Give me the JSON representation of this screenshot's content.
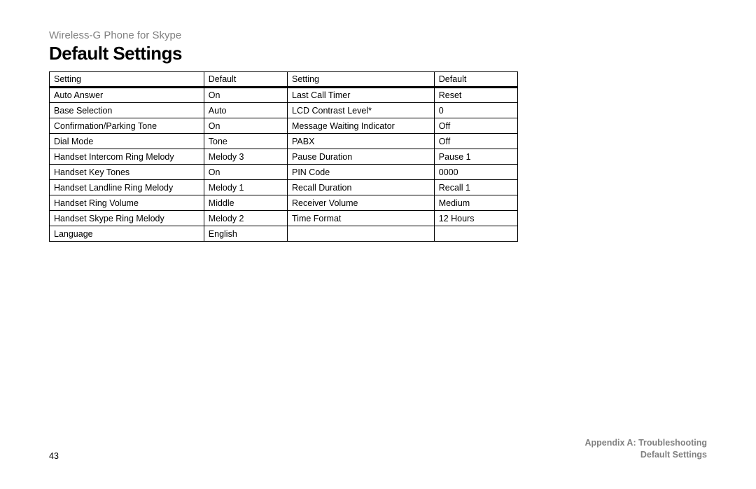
{
  "header": {
    "subtitle": "Wireless-G Phone for Skype",
    "title": "Default Settings"
  },
  "table": {
    "headers": [
      "Setting",
      "Default",
      "Setting",
      "Default"
    ],
    "rows": [
      {
        "c1": "Auto Answer",
        "c2": "On",
        "c3": "Last Call Timer",
        "c4": "Reset"
      },
      {
        "c1": "Base Selection",
        "c2": "Auto",
        "c3": "LCD Contrast Level*",
        "c4": "0"
      },
      {
        "c1": "Confirmation/Parking Tone",
        "c2": "On",
        "c3": "Message Waiting Indicator",
        "c4": "Off"
      },
      {
        "c1": "Dial Mode",
        "c2": "Tone",
        "c3": "PABX",
        "c4": "Off"
      },
      {
        "c1": "Handset Intercom Ring Melody",
        "c2": "Melody 3",
        "c3": "Pause Duration",
        "c4": "Pause 1"
      },
      {
        "c1": "Handset Key Tones",
        "c2": "On",
        "c3": "PIN Code",
        "c4": "0000"
      },
      {
        "c1": "Handset Landline Ring Melody",
        "c2": "Melody 1",
        "c3": "Recall Duration",
        "c4": "Recall 1"
      },
      {
        "c1": "Handset Ring Volume",
        "c2": "Middle",
        "c3": "Receiver Volume",
        "c4": "Medium"
      },
      {
        "c1": "Handset Skype Ring Melody",
        "c2": "Melody 2",
        "c3": "Time Format",
        "c4": "12 Hours"
      },
      {
        "c1": "Language",
        "c2": "English",
        "c3": "",
        "c4": ""
      }
    ]
  },
  "footer": {
    "page": "43",
    "appendix": "Appendix A: Troubleshooting",
    "section": "Default Settings"
  }
}
